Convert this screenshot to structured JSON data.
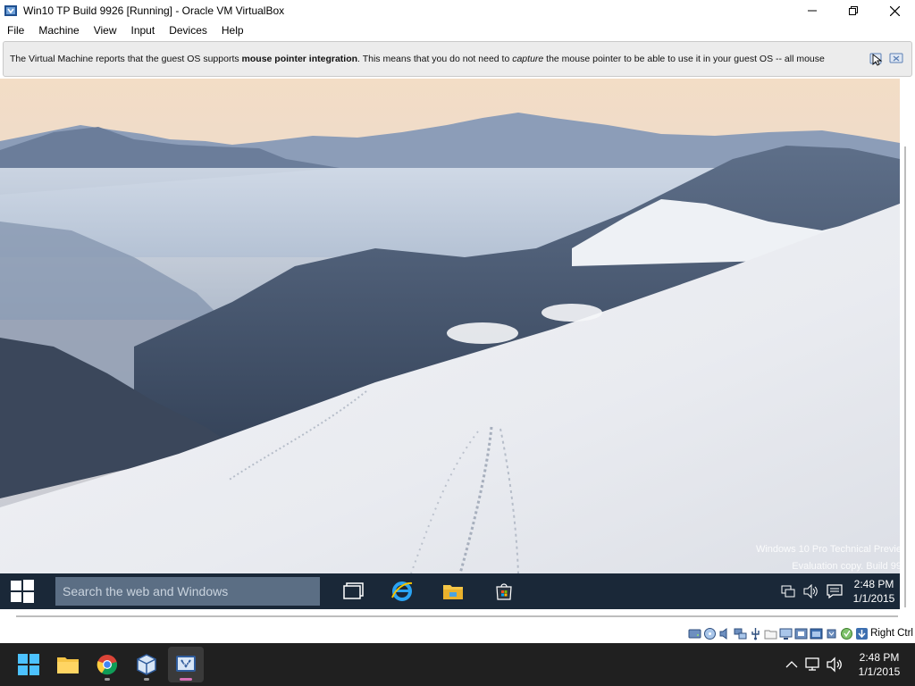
{
  "window": {
    "title": "Win10 TP Build 9926 [Running] - Oracle VM VirtualBox",
    "controls": [
      "minimize-icon",
      "maximize-icon",
      "close-icon"
    ]
  },
  "menu": [
    "File",
    "Machine",
    "View",
    "Input",
    "Devices",
    "Help"
  ],
  "notice": {
    "part1": "The Virtual Machine reports that the guest OS supports ",
    "bold": "mouse pointer integration",
    "part2": ". This means that you do not need to ",
    "italic": "capture",
    "part3": " the mouse pointer to be able to use it in your guest OS -- all mouse"
  },
  "guest": {
    "watermark_line1": "Windows 10 Pro Technical Previe",
    "watermark_line2": "Evaluation copy. Build 99",
    "search_placeholder": "Search the web and Windows",
    "pinned": [
      "task-view-icon",
      "internet-explorer-icon",
      "file-explorer-icon",
      "store-icon"
    ],
    "tray_icons": [
      "network-icon",
      "volume-icon",
      "action-center-icon"
    ],
    "clock_time": "2:48 PM",
    "clock_date": "1/1/2015",
    "colors": {
      "taskbar": "#1a2838",
      "search": "#5b6e84"
    }
  },
  "statusbar": {
    "host_key": "Right Ctrl",
    "icons": [
      "hard-disk-icon",
      "optical-drive-icon",
      "audio-icon",
      "network-adapter-icon",
      "usb-icon",
      "shared-folders-icon",
      "display-icon",
      "video-capture-icon",
      "vm-window-icon",
      "cpu-icon",
      "mouse-integration-icon",
      "download-icon"
    ]
  },
  "host": {
    "apps": [
      "windows-start-icon",
      "file-explorer-icon",
      "chrome-icon",
      "virtualbox-icon",
      "virtualbox-vm-icon"
    ],
    "active_app": "virtualbox-vm-icon",
    "clock_time": "2:48 PM",
    "clock_date": "1/1/2015",
    "tray_icons": [
      "chevron-up-icon",
      "network-icon",
      "volume-icon"
    ]
  }
}
